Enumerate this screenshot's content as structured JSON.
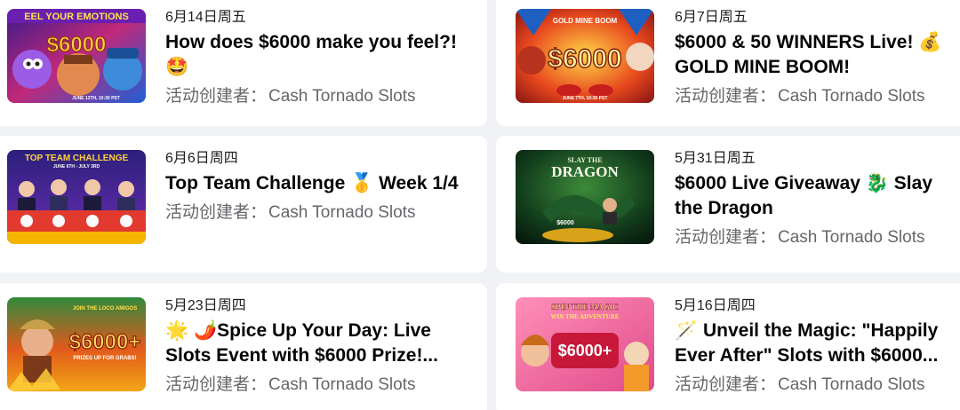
{
  "events": [
    {
      "date": "6月14日周五",
      "title": "How does $6000 make you feel?! 🤩",
      "host_label": "活动创建者：",
      "host_name": "Cash Tornado Slots",
      "thumb": {
        "headline": "EEL YOUR EMOTIONS",
        "amount": "$6000",
        "note": "JUNE 13TH, 10:30 PST"
      }
    },
    {
      "date": "6月7日周五",
      "title": "$6000 & 50 WINNERS Live! 💰 GOLD MINE BOOM!",
      "host_label": "活动创建者：",
      "host_name": "Cash Tornado Slots",
      "thumb": {
        "headline": "GOLD MINE BOOM",
        "amount": "$6000",
        "note": "JUNE 7TH, 10:30 PST"
      }
    },
    {
      "date": "6月6日周四",
      "title": "Top Team Challenge 🥇 Week 1/4",
      "host_label": "活动创建者：",
      "host_name": "Cash Tornado Slots",
      "thumb": {
        "headline": "TOP TEAM CHALLENGE",
        "subline": "JUNE 6TH - JULY 3RD"
      }
    },
    {
      "date": "5月31日周五",
      "title": "$6000 Live Giveaway 🐉 Slay the Dragon",
      "host_label": "活动创建者：",
      "host_name": "Cash Tornado Slots",
      "thumb": {
        "headline": "SLAY THE",
        "headline2": "DRAGON",
        "amount": "$6000"
      }
    },
    {
      "date": "5月23日周四",
      "title": "🌟 🌶️Spice Up Your Day: Live Slots Event with $6000 Prize!...",
      "host_label": "活动创建者：",
      "host_name": "Cash Tornado Slots",
      "thumb": {
        "headline": "JOIN THE LOCO AMIGOS",
        "amount": "$6000+",
        "note": "PRIZES UP FOR GRABS!"
      }
    },
    {
      "date": "5月16日周四",
      "title": "🪄 Unveil the Magic: \"Happily Ever After\" Slots with $6000...",
      "host_label": "活动创建者：",
      "host_name": "Cash Tornado Slots",
      "thumb": {
        "headline": "SPIN THE MAGIC",
        "headline2": "WIN THE ADVENTURE",
        "amount": "$6000+"
      }
    }
  ],
  "colors": {
    "page_bg": "#f0f2f5",
    "card_bg": "#ffffff",
    "title": "#050505",
    "date": "#1c1e21",
    "host": "#65676b"
  }
}
